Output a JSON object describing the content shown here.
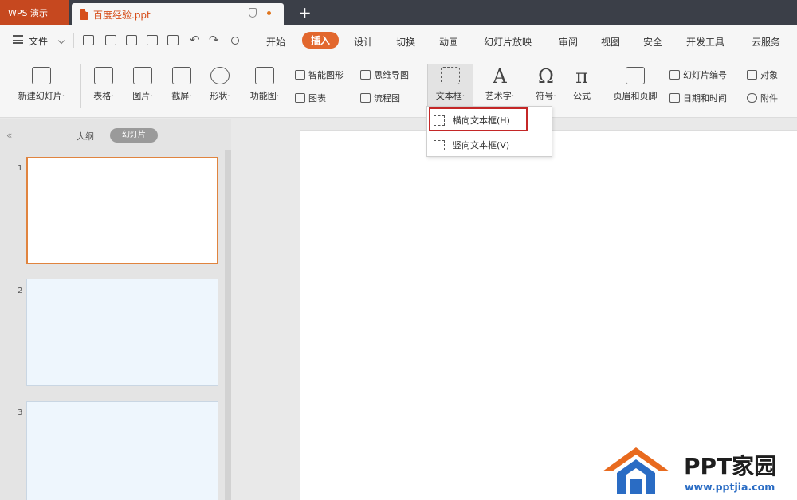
{
  "titlebar": {
    "app_tab": "WPS 演示",
    "doc_tab": "百度经验.ppt",
    "new_tab_glyph": "+"
  },
  "menubar": {
    "file_label": "文件",
    "undo_glyph": "↶",
    "redo_glyph": "↷",
    "tabs": [
      "开始",
      "插入",
      "设计",
      "切换",
      "动画",
      "幻灯片放映",
      "审阅",
      "视图",
      "安全",
      "开发工具",
      "云服务"
    ],
    "active_tab": "插入"
  },
  "ribbon": {
    "new_slide": "新建幻灯片·",
    "table": "表格·",
    "picture": "图片·",
    "screenshot": "截屏·",
    "shape": "形状·",
    "icon_lib": "功能图·",
    "smart_art": "智能图形",
    "mind_map": "思维导图",
    "chart": "图表",
    "flowchart": "流程图",
    "textbox": "文本框·",
    "wordart": "艺术字·",
    "symbol": "符号·",
    "formula": "公式",
    "header_footer": "页眉和页脚",
    "slide_number": "幻灯片编号",
    "object": "对象",
    "datetime": "日期和时间",
    "attachment": "附件",
    "wordart_glyph": "A",
    "symbol_glyph": "Ω",
    "formula_glyph": "π"
  },
  "dropdown": {
    "items": [
      "横向文本框(H)",
      "竖向文本框(V)"
    ],
    "highlighted_index": 0,
    "highlight_color": "#c42727"
  },
  "leftpane": {
    "collapse_glyph": "«",
    "outline_tab": "大纲",
    "slides_tab": "幻灯片",
    "thumbnails": [
      {
        "number": "1",
        "selected": true
      },
      {
        "number": "2",
        "selected": false
      },
      {
        "number": "3",
        "selected": false
      }
    ]
  },
  "watermark": {
    "brand": "PPT家园",
    "url": "www.pptjia.com",
    "colors": {
      "orange": "#e86a1e",
      "blue": "#2a6cc4"
    }
  },
  "colors": {
    "accent": "#e2672d",
    "titlebar": "#3b3f48",
    "app_tab": "#c6481f",
    "doc_title": "#d64f1c"
  }
}
